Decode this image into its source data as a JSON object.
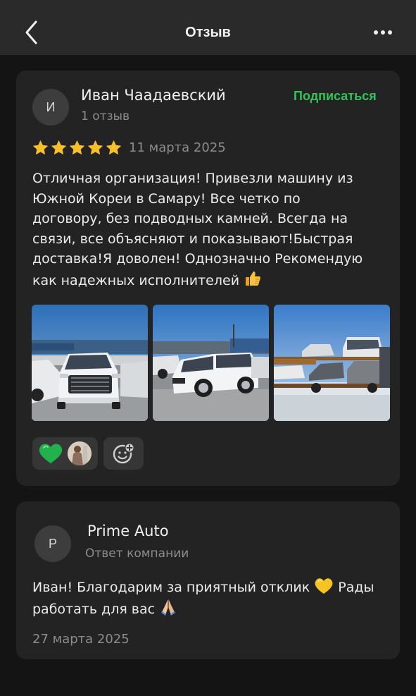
{
  "header": {
    "title": "Отзыв"
  },
  "review": {
    "author_initial": "И",
    "author_name": "Иван Чаадаевский",
    "author_reviews": "1 отзыв",
    "subscribe_label": "Подписаться",
    "rating": 5,
    "date": "11 марта 2025",
    "text_lines": [
      "Отличная организация! Привезли машину из",
      "Южной Кореи в Самару! Все четко по",
      "договору, без подводных камней. Всегда на",
      "связи, все объясняют и показывают!Быстрая",
      "доставка!Я доволен! Однозначно Рекомендую",
      "как надежных исполнителей"
    ],
    "text_emoji": "thumbs-up-emoji",
    "photos": [
      "photo-white-suv-front",
      "photo-white-suv-side",
      "photo-car-carrier-truck"
    ],
    "reactions": {
      "emoji": "green-heart-emoji",
      "user_avatar": "reactor-avatar"
    },
    "colors": {
      "accent_green": "#32c35c",
      "star": "#f5c02a"
    }
  },
  "reply": {
    "author_initial": "P",
    "author_name": "Prime Auto",
    "author_role": "Ответ компании",
    "text_lines": [
      "Иван! Благодарим за приятный отклик",
      "Рады",
      "работать для вас"
    ],
    "date": "27 марта 2025"
  }
}
